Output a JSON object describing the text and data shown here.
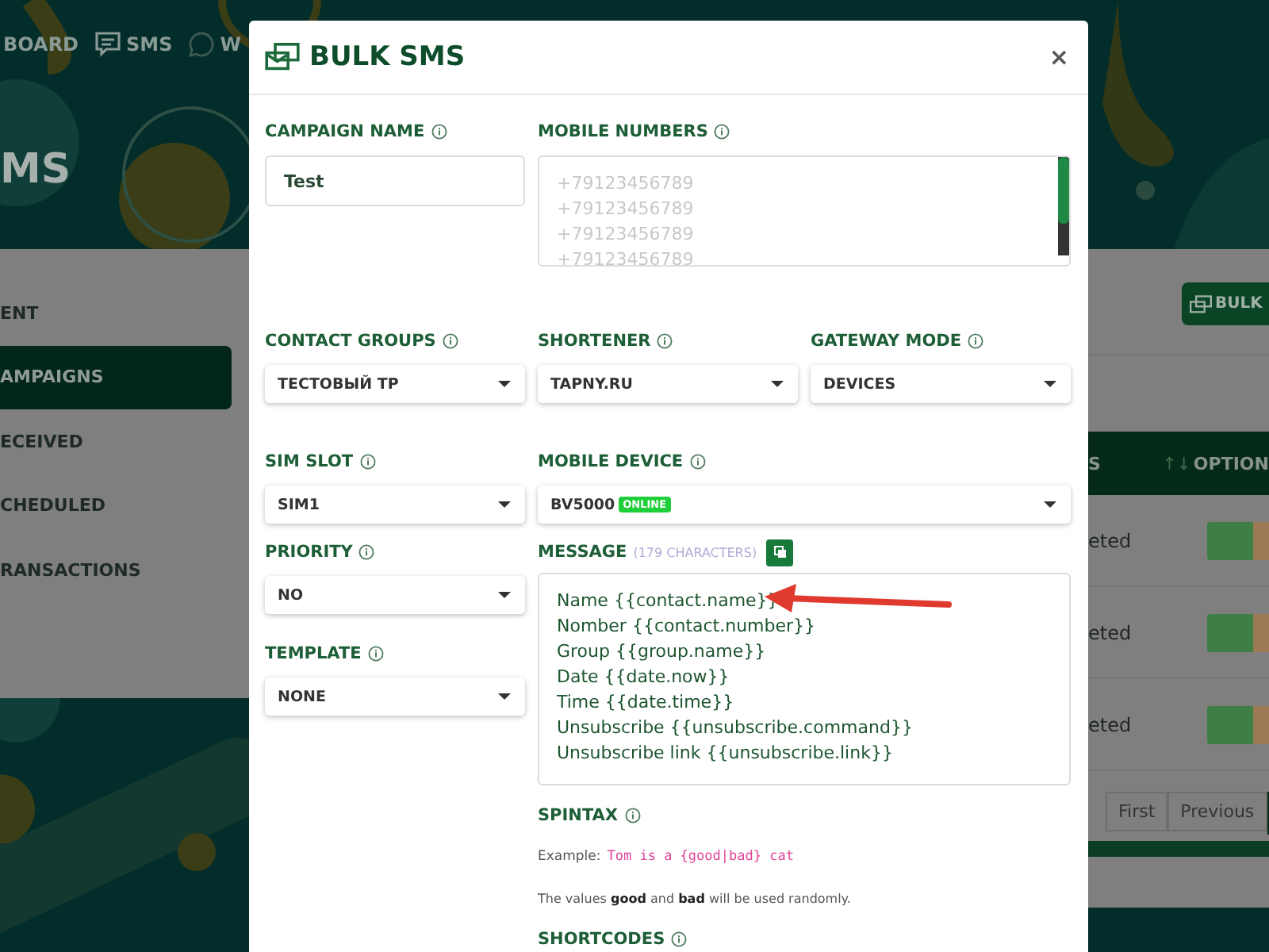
{
  "background": {
    "nav": [
      {
        "kind": "dashboard",
        "label": "BOARD"
      },
      {
        "kind": "sms",
        "label": "SMS"
      },
      {
        "kind": "whatsapp",
        "label": "W"
      }
    ],
    "page_title": "MS",
    "sidebar": {
      "items": [
        {
          "label": "ENT",
          "selected": false
        },
        {
          "label": "AMPAIGNS",
          "selected": true
        },
        {
          "label": "ECEIVED",
          "selected": false
        },
        {
          "label": "CHEDULED",
          "selected": false
        },
        {
          "label": "RANSACTIONS",
          "selected": false
        }
      ]
    },
    "bulk_button": "BULK",
    "table": {
      "columns": [
        "S",
        "↑↓",
        "OPTION"
      ],
      "rows": [
        {
          "status": "eted"
        },
        {
          "status": "eted"
        },
        {
          "status": "eted"
        }
      ]
    },
    "pagination": [
      "First",
      "Previous"
    ]
  },
  "modal": {
    "title": "BULK SMS",
    "close": "×",
    "campaign_name": {
      "label": "CAMPAIGN NAME",
      "value": "Test"
    },
    "mobile_numbers": {
      "label": "MOBILE NUMBERS",
      "placeholder": [
        "+79123456789",
        "+79123456789",
        "+79123456789",
        "+79123456789"
      ]
    },
    "selects": [
      {
        "label": "CONTACT GROUPS",
        "value": "ТЕСТОВЫЙ ТР"
      },
      {
        "label": "SHORTENER",
        "value": "TAPNY.RU"
      },
      {
        "label": "GATEWAY MODE",
        "value": "DEVICES"
      }
    ],
    "sim_slot": {
      "label": "SIM SLOT",
      "value": "SIM1"
    },
    "mobile_device": {
      "label": "MOBILE DEVICE",
      "value": "BV5000",
      "badge": "ONLINE"
    },
    "priority": {
      "label": "PRIORITY",
      "value": "NO"
    },
    "template": {
      "label": "TEMPLATE",
      "value": "NONE"
    },
    "message": {
      "label": "MESSAGE",
      "count": "(179 CHARACTERS)",
      "lines": [
        "Name {{contact.name}}",
        "Nomber {{contact.number}}",
        "Group {{group.name}}",
        "Date {{date.now}}",
        "Time {{date.time}}",
        "Unsubscribe {{unsubscribe.command}}",
        "Unsubscribe link {{unsubscribe.link}}"
      ]
    },
    "spintax": {
      "label": "SPINTAX",
      "example_label": "Example:",
      "example_code": "Tom is a {good|bad} cat",
      "note": "The values **good** and **bad** will be used randomly."
    },
    "shortcodes": {
      "label": "SHORTCODES"
    }
  }
}
